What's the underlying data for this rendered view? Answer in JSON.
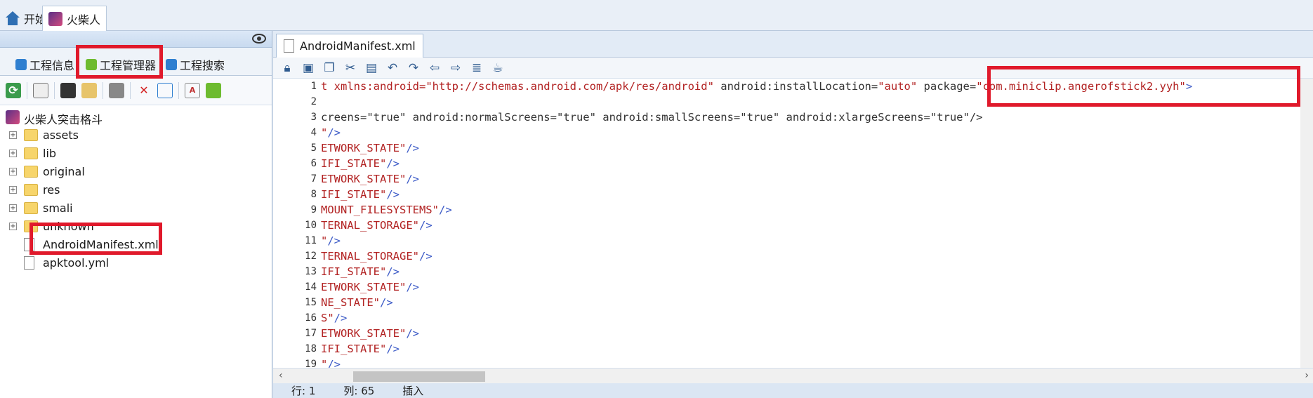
{
  "top_tabs": [
    {
      "label": "开始",
      "icon": "home-icon"
    },
    {
      "label": "火柴人",
      "icon": "app-icon"
    }
  ],
  "left_tabs": [
    {
      "label": "工程信息",
      "icon": "info-icon"
    },
    {
      "label": "工程管理器",
      "icon": "android-icon"
    },
    {
      "label": "工程搜索",
      "icon": "search-icon"
    }
  ],
  "tree": {
    "root": "火柴人突击格斗",
    "items": [
      {
        "label": "assets",
        "type": "folder"
      },
      {
        "label": "lib",
        "type": "folder"
      },
      {
        "label": "original",
        "type": "folder"
      },
      {
        "label": "res",
        "type": "folder"
      },
      {
        "label": "smali",
        "type": "folder"
      },
      {
        "label": "unknown",
        "type": "folder"
      },
      {
        "label": "AndroidManifest.xml",
        "type": "file"
      },
      {
        "label": "apktool.yml",
        "type": "file"
      }
    ]
  },
  "editor": {
    "tab_label": "AndroidManifest.xml",
    "lines": [
      {
        "n": "1",
        "text": ""
      },
      {
        "n": "2",
        "text": ""
      },
      {
        "n": "3",
        "text": "creens=\"true\" android:normalScreens=\"true\" android:smallScreens=\"true\" android:xlargeScreens=\"true\"/>"
      },
      {
        "n": "4",
        "text": "\"/>"
      },
      {
        "n": "5",
        "text": "ETWORK_STATE\"/>"
      },
      {
        "n": "6",
        "text": "IFI_STATE\"/>"
      },
      {
        "n": "7",
        "text": "ETWORK_STATE\"/>"
      },
      {
        "n": "8",
        "text": "IFI_STATE\"/>"
      },
      {
        "n": "9",
        "text": "MOUNT_FILESYSTEMS\"/>"
      },
      {
        "n": "10",
        "text": "TERNAL_STORAGE\"/>"
      },
      {
        "n": "11",
        "text": "\"/>"
      },
      {
        "n": "12",
        "text": "TERNAL_STORAGE\"/>"
      },
      {
        "n": "13",
        "text": "IFI_STATE\"/>"
      },
      {
        "n": "14",
        "text": "ETWORK_STATE\"/>"
      },
      {
        "n": "15",
        "text": "NE_STATE\"/>"
      },
      {
        "n": "16",
        "text": "S\"/>"
      },
      {
        "n": "17",
        "text": "ETWORK_STATE\"/>"
      },
      {
        "n": "18",
        "text": "IFI_STATE\"/>"
      },
      {
        "n": "19",
        "text": "\"/>"
      }
    ],
    "line1": {
      "prefix": "t xmlns:android=",
      "xmlns_val": "\"http://schemas.android.com/apk/res/android\"",
      "install_attr": " android:installLocation=",
      "install_val": "\"auto\"",
      "package_attr": " package=",
      "package_val": "\"com.miniclip.angerofstick2.yyh\"",
      "close": ">"
    }
  },
  "status": {
    "row": "行: 1",
    "col": "列: 65",
    "mode": "插入"
  },
  "colors": {
    "highlight": "#e0192b",
    "code_value": "#b22222",
    "code_tag": "#3d5bc7"
  }
}
